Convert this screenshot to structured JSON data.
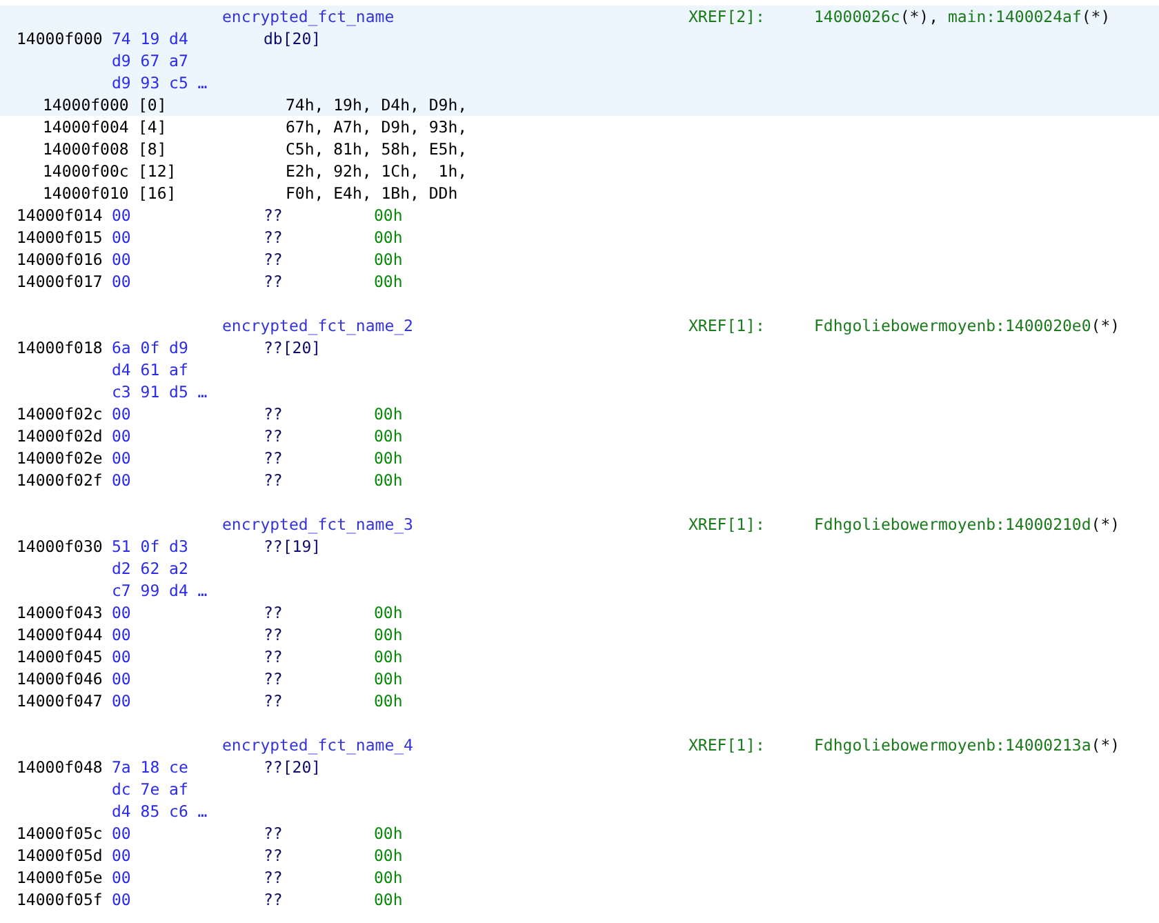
{
  "blocks": [
    {
      "label": "encrypted_fct_name",
      "xref_label": "XREF[2]:",
      "xrefs": [
        {
          "target": "14000026c",
          "suffix": "(*), "
        },
        {
          "target": "main:1400024af",
          "suffix": "(*)"
        }
      ],
      "address": "14000f000",
      "bytes": [
        "74 19 d4",
        "d9 67 a7",
        "d9 93 c5 …"
      ],
      "mnemonic": "db[20]",
      "selected": true,
      "elements": [
        {
          "address": "14000f000",
          "index": "[0]",
          "values": "74h, 19h, D4h, D9h,",
          "selected": true
        },
        {
          "address": "14000f004",
          "index": "[4]",
          "values": "67h, A7h, D9h, 93h,",
          "selected": false
        },
        {
          "address": "14000f008",
          "index": "[8]",
          "values": "C5h, 81h, 58h, E5h,",
          "selected": false
        },
        {
          "address": "14000f00c",
          "index": "[12]",
          "values": "E2h, 92h, 1Ch,  1h,",
          "selected": false
        },
        {
          "address": "14000f010",
          "index": "[16]",
          "values": "F0h, E4h, 1Bh, DDh",
          "selected": false
        }
      ],
      "fillers": [
        {
          "address": "14000f014",
          "byte": "00",
          "mnemonic": "??",
          "operand": "00h"
        },
        {
          "address": "14000f015",
          "byte": "00",
          "mnemonic": "??",
          "operand": "00h"
        },
        {
          "address": "14000f016",
          "byte": "00",
          "mnemonic": "??",
          "operand": "00h"
        },
        {
          "address": "14000f017",
          "byte": "00",
          "mnemonic": "??",
          "operand": "00h"
        }
      ]
    },
    {
      "label": "encrypted_fct_name_2",
      "xref_label": "XREF[1]:",
      "xrefs": [
        {
          "target": "Fdhgoliebowermoyenb:1400020e0",
          "suffix": "(*)"
        }
      ],
      "address": "14000f018",
      "bytes": [
        "6a 0f d9",
        "d4 61 af",
        "c3 91 d5 …"
      ],
      "mnemonic": "??[20]",
      "selected": false,
      "fillers": [
        {
          "address": "14000f02c",
          "byte": "00",
          "mnemonic": "??",
          "operand": "00h"
        },
        {
          "address": "14000f02d",
          "byte": "00",
          "mnemonic": "??",
          "operand": "00h"
        },
        {
          "address": "14000f02e",
          "byte": "00",
          "mnemonic": "??",
          "operand": "00h"
        },
        {
          "address": "14000f02f",
          "byte": "00",
          "mnemonic": "??",
          "operand": "00h"
        }
      ]
    },
    {
      "label": "encrypted_fct_name_3",
      "xref_label": "XREF[1]:",
      "xrefs": [
        {
          "target": "Fdhgoliebowermoyenb:14000210d",
          "suffix": "(*)"
        }
      ],
      "address": "14000f030",
      "bytes": [
        "51 0f d3",
        "d2 62 a2",
        "c7 99 d4 …"
      ],
      "mnemonic": "??[19]",
      "selected": false,
      "fillers": [
        {
          "address": "14000f043",
          "byte": "00",
          "mnemonic": "??",
          "operand": "00h"
        },
        {
          "address": "14000f044",
          "byte": "00",
          "mnemonic": "??",
          "operand": "00h"
        },
        {
          "address": "14000f045",
          "byte": "00",
          "mnemonic": "??",
          "operand": "00h"
        },
        {
          "address": "14000f046",
          "byte": "00",
          "mnemonic": "??",
          "operand": "00h"
        },
        {
          "address": "14000f047",
          "byte": "00",
          "mnemonic": "??",
          "operand": "00h"
        }
      ]
    },
    {
      "label": "encrypted_fct_name_4",
      "xref_label": "XREF[1]:",
      "xrefs": [
        {
          "target": "Fdhgoliebowermoyenb:14000213a",
          "suffix": "(*)"
        }
      ],
      "address": "14000f048",
      "bytes": [
        "7a 18 ce",
        "dc 7e af",
        "d4 85 c6 …"
      ],
      "mnemonic": "??[20]",
      "selected": false,
      "fillers": [
        {
          "address": "14000f05c",
          "byte": "00",
          "mnemonic": "??",
          "operand": "00h"
        },
        {
          "address": "14000f05d",
          "byte": "00",
          "mnemonic": "??",
          "operand": "00h"
        },
        {
          "address": "14000f05e",
          "byte": "00",
          "mnemonic": "??",
          "operand": "00h"
        },
        {
          "address": "14000f05f",
          "byte": "00",
          "mnemonic": "??",
          "operand": "00h"
        }
      ]
    }
  ]
}
